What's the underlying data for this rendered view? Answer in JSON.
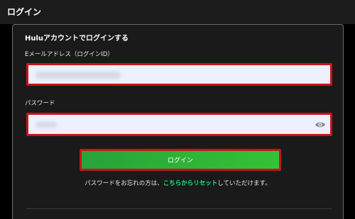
{
  "header": {
    "title": "ログイン"
  },
  "form": {
    "section_title": "Huluアカウントでログインする",
    "email_label": "Eメールアドレス（ログインID）",
    "email_value": "",
    "password_label": "パスワード",
    "password_value": "",
    "password_toggle_icon": "eye-icon",
    "login_button_label": "ログイン",
    "reset_text_before": "パスワードをお忘れの方は、",
    "reset_link_label": "こちらからリセット",
    "reset_text_after": "していただけます。"
  },
  "colors": {
    "background": "#000000",
    "panel": "#1a1a1a",
    "highlight_border": "#c8141a",
    "button_green": "#2fb536",
    "link_green": "#1ce783",
    "input_bg": "#eef0fb"
  }
}
